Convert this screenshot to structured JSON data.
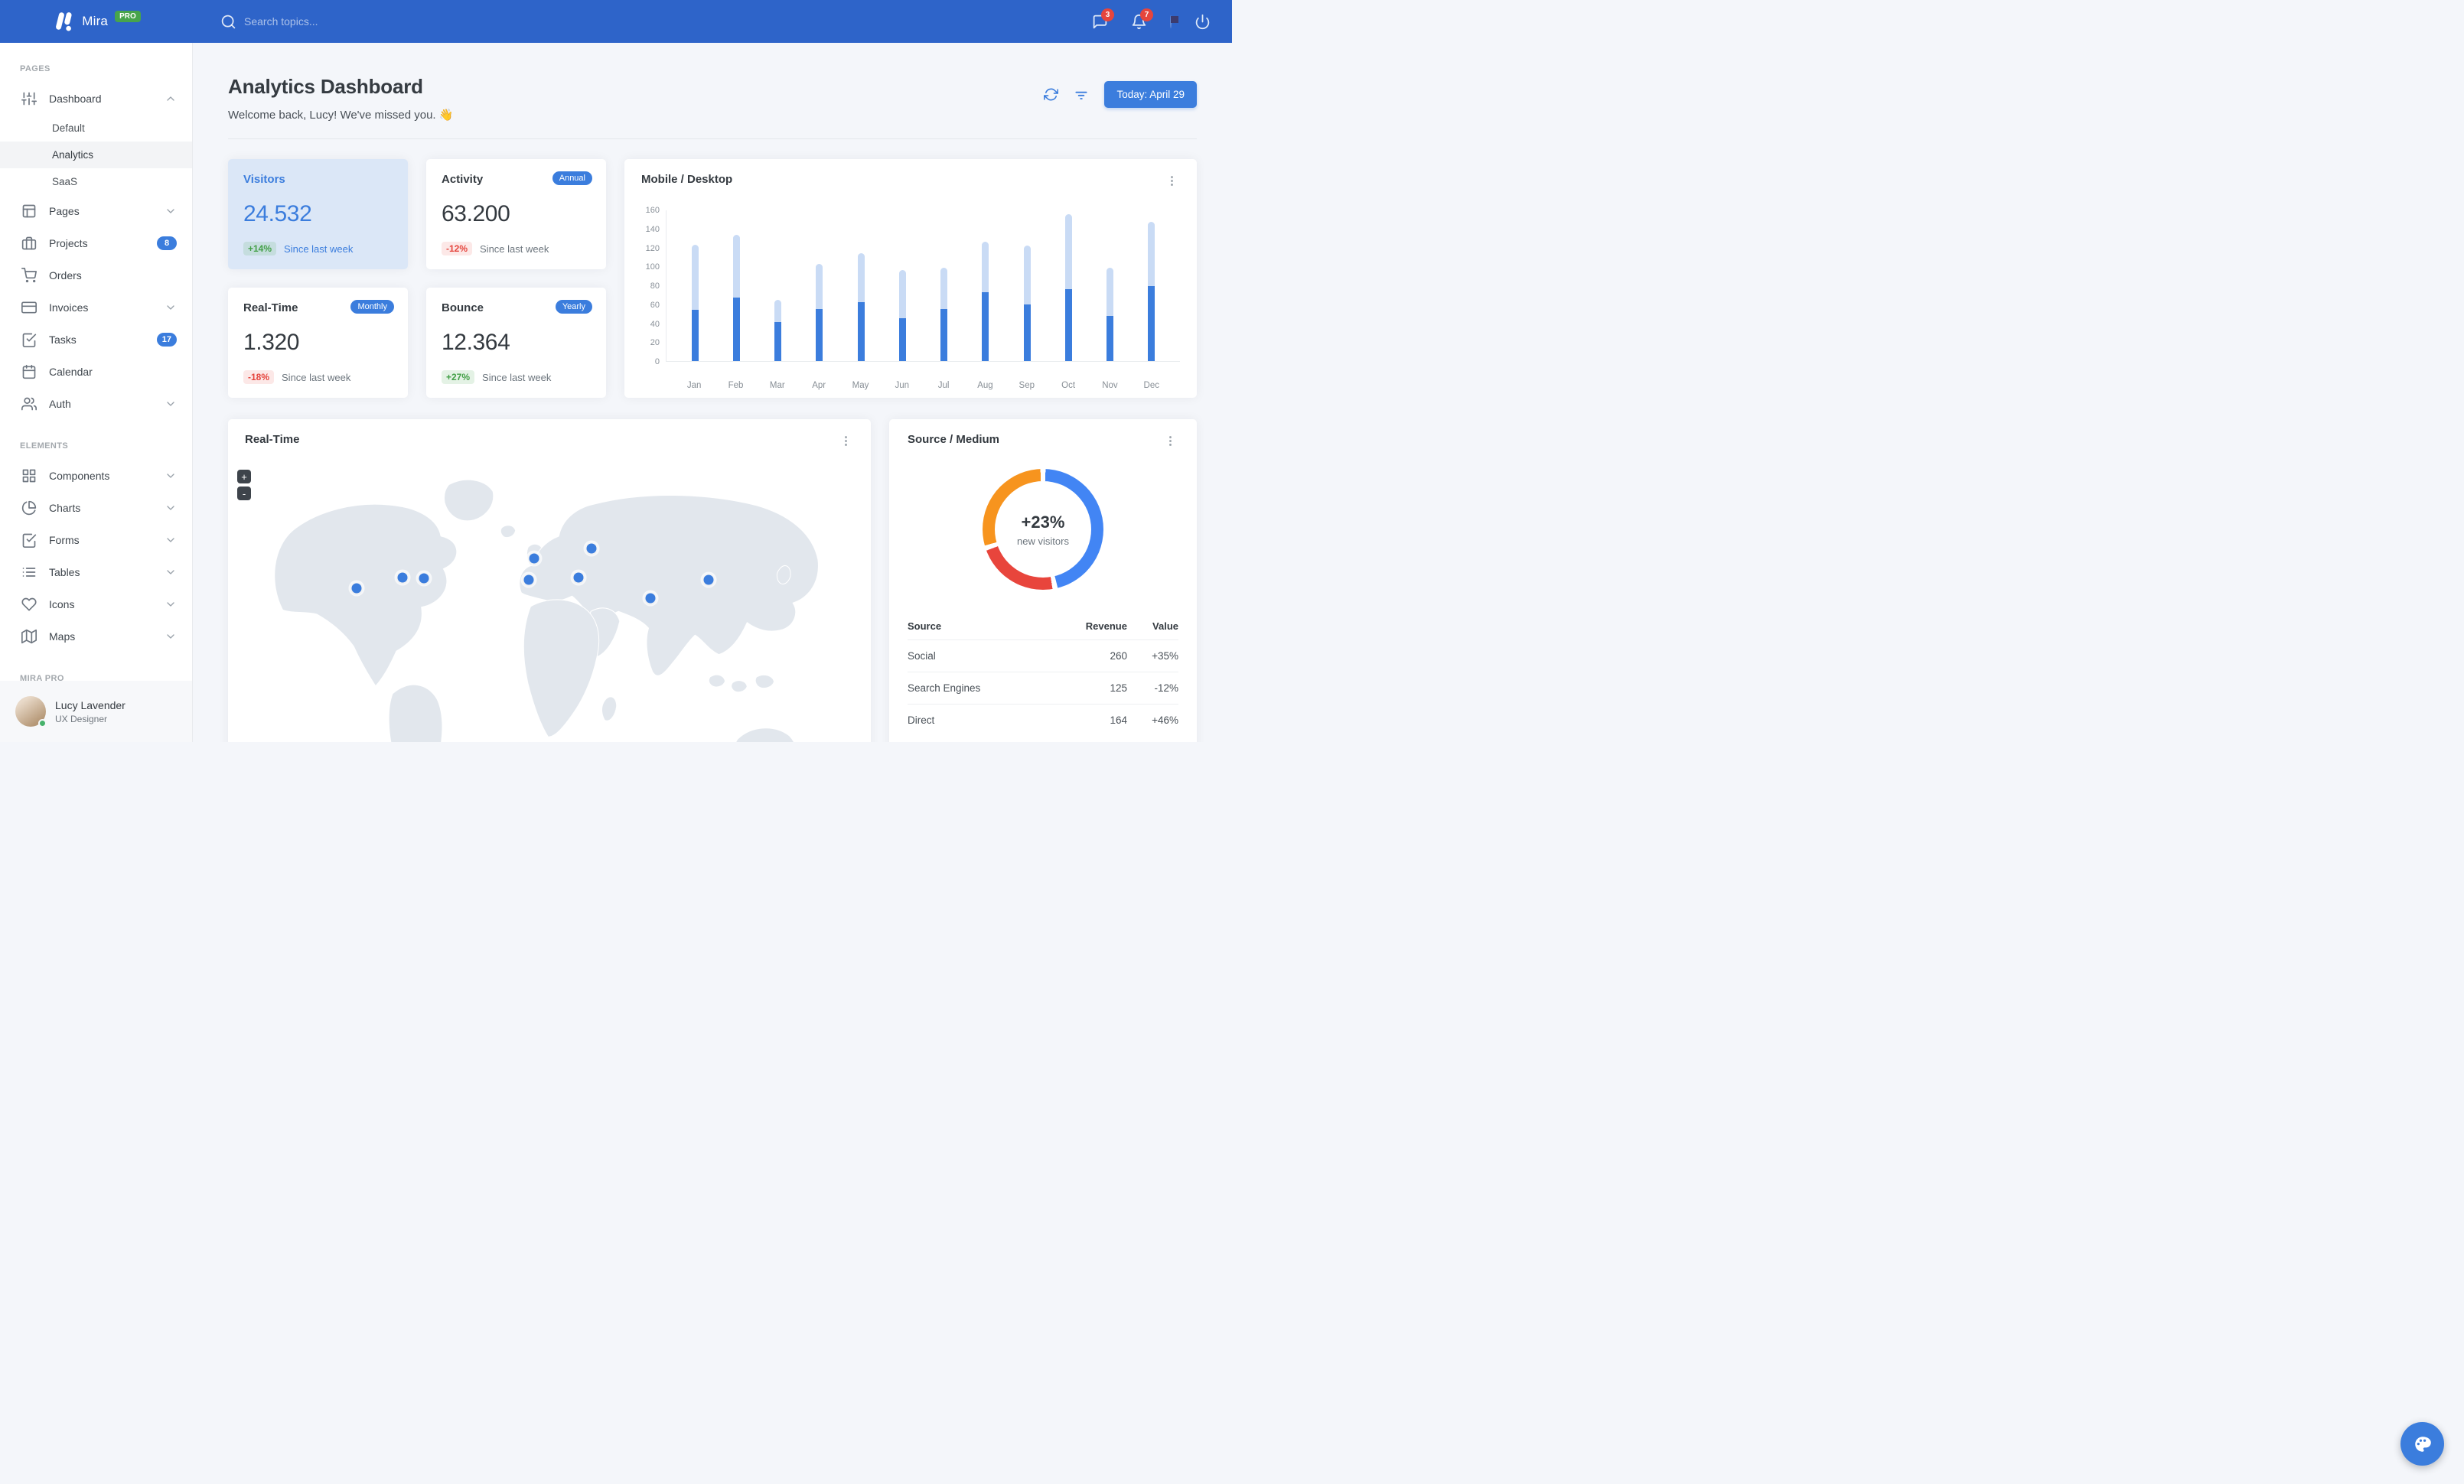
{
  "navbar": {
    "brand": "Mira",
    "brand_badge": "PRO",
    "search_placeholder": "Search topics...",
    "messages_badge": "3",
    "alerts_badge": "7"
  },
  "sidebar": {
    "sections": [
      {
        "label": "PAGES",
        "items": [
          {
            "label": "Dashboard",
            "icon": "sliders-icon",
            "chevron": "up",
            "children": [
              {
                "label": "Default",
                "selected": false
              },
              {
                "label": "Analytics",
                "selected": true
              },
              {
                "label": "SaaS",
                "selected": false
              }
            ]
          },
          {
            "label": "Pages",
            "icon": "layout-icon",
            "chevron": "down"
          },
          {
            "label": "Projects",
            "icon": "briefcase-icon",
            "badge": "8"
          },
          {
            "label": "Orders",
            "icon": "shopping-cart-icon"
          },
          {
            "label": "Invoices",
            "icon": "credit-card-icon",
            "chevron": "down"
          },
          {
            "label": "Tasks",
            "icon": "check-square-icon",
            "badge": "17"
          },
          {
            "label": "Calendar",
            "icon": "calendar-icon"
          },
          {
            "label": "Auth",
            "icon": "users-icon",
            "chevron": "down"
          }
        ]
      },
      {
        "label": "ELEMENTS",
        "items": [
          {
            "label": "Components",
            "icon": "grid-icon",
            "chevron": "down"
          },
          {
            "label": "Charts",
            "icon": "pie-chart-icon",
            "chevron": "down"
          },
          {
            "label": "Forms",
            "icon": "check-square-icon",
            "chevron": "down"
          },
          {
            "label": "Tables",
            "icon": "list-icon",
            "chevron": "down"
          },
          {
            "label": "Icons",
            "icon": "heart-icon",
            "chevron": "down"
          },
          {
            "label": "Maps",
            "icon": "map-icon",
            "chevron": "down"
          }
        ]
      },
      {
        "label": "MIRA PRO",
        "items": []
      }
    ],
    "user": {
      "name": "Lucy Lavender",
      "role": "UX Designer",
      "status": "online"
    }
  },
  "header": {
    "title": "Analytics Dashboard",
    "subtitle": "Welcome back, Lucy! We've missed you. 👋",
    "today_button": "Today: April 29"
  },
  "stats": [
    {
      "title": "Visitors",
      "value": "24.532",
      "change": "+14%",
      "caption": "Since last week",
      "variant": "primary"
    },
    {
      "title": "Activity",
      "badge": "Annual",
      "value": "63.200",
      "change": "-12%",
      "caption": "Since last week"
    },
    {
      "title": "Real-Time",
      "badge": "Monthly",
      "value": "1.320",
      "change": "-18%",
      "caption": "Since last week"
    },
    {
      "title": "Bounce",
      "badge": "Yearly",
      "value": "12.364",
      "change": "+27%",
      "caption": "Since last week"
    }
  ],
  "chart_data": [
    {
      "type": "bar",
      "title": "Mobile / Desktop",
      "stacked": true,
      "categories": [
        "Jan",
        "Feb",
        "Mar",
        "Apr",
        "May",
        "Jun",
        "Jul",
        "Aug",
        "Sep",
        "Oct",
        "Nov",
        "Dec"
      ],
      "series": [
        {
          "name": "Mobile",
          "color": "#3B7DDD",
          "values": [
            54,
            67,
            41,
            55,
            62,
            45,
            55,
            73,
            60,
            76,
            48,
            79
          ]
        },
        {
          "name": "Desktop",
          "color": "#C9DBF5",
          "values": [
            69,
            66,
            24,
            48,
            52,
            51,
            44,
            53,
            62,
            79,
            51,
            68
          ]
        }
      ],
      "ylabel": "",
      "xlabel": "",
      "ylim": [
        0,
        160
      ],
      "ytick_step": 20,
      "grid": false,
      "legend": "none"
    },
    {
      "type": "pie",
      "donut": true,
      "title": "Source / Medium",
      "center_value": "+23%",
      "center_label": "new visitors",
      "segments": [
        {
          "label": "Social",
          "value": 260,
          "color": "#4285F4"
        },
        {
          "label": "Search Engines",
          "value": 125,
          "color": "#E8453C"
        },
        {
          "label": "Direct",
          "value": 164,
          "color": "#F7941E"
        }
      ]
    }
  ],
  "map_card": {
    "title": "Real-Time",
    "zoom_in": "+",
    "zoom_out": "-",
    "marker_count": 9
  },
  "source_table": {
    "headers": [
      "Source",
      "Revenue",
      "Value"
    ],
    "rows": [
      {
        "source": "Social",
        "revenue": "260",
        "value": "+35%"
      },
      {
        "source": "Search Engines",
        "revenue": "125",
        "value": "-12%"
      },
      {
        "source": "Direct",
        "revenue": "164",
        "value": "+46%"
      }
    ]
  },
  "colors": {
    "accent": "#3B7DDD",
    "navbar": "#2E64C9",
    "success": "#43A047",
    "danger": "#E5453D",
    "visitors_card": "#DBE7F7",
    "bar_light": "#C9DBF5"
  }
}
